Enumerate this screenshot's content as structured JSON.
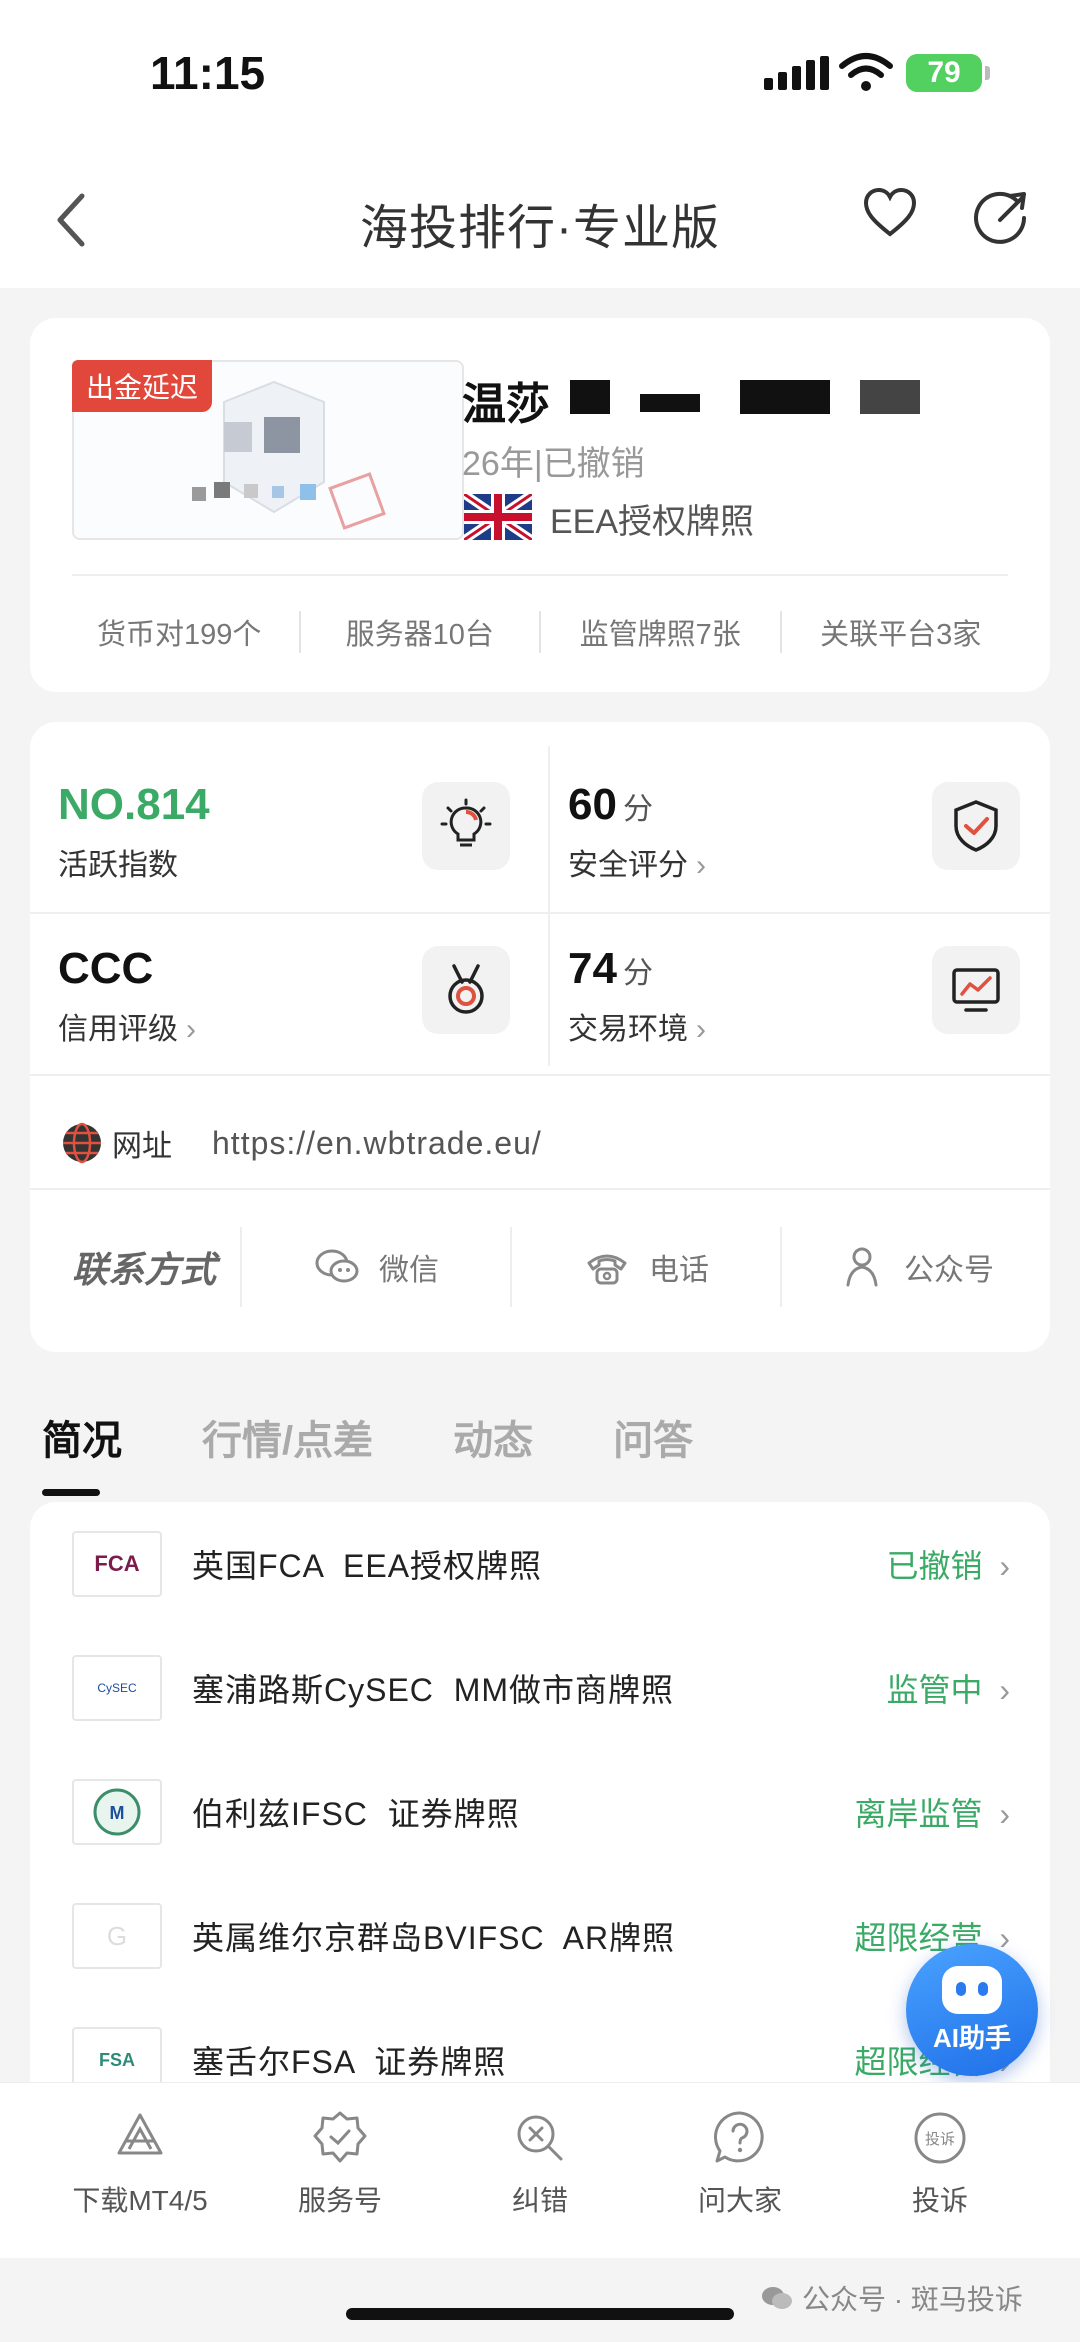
{
  "status_bar": {
    "time": "11:15",
    "battery": "79"
  },
  "nav": {
    "title": "海投排行·专业版"
  },
  "broker": {
    "delay_badge": "出金延迟",
    "name": "温莎",
    "meta": "26年|已撤销",
    "license": "EEA授权牌照",
    "stats": [
      "货币对199个",
      "服务器10台",
      "监管牌照7张",
      "关联平台3家"
    ]
  },
  "scores": {
    "activity": {
      "value": "NO.814",
      "label": "活跃指数"
    },
    "safety": {
      "value": "60",
      "unit": "分",
      "label": "安全评分"
    },
    "credit": {
      "value": "CCC",
      "label": "信用评级"
    },
    "trading": {
      "value": "74",
      "unit": "分",
      "label": "交易环境"
    }
  },
  "website": {
    "label": "网址",
    "url": "https://en.wbtrade.eu/"
  },
  "contact": {
    "title": "联系方式",
    "items": [
      "微信",
      "电话",
      "公众号"
    ]
  },
  "tabs": [
    "简况",
    "行情/点差",
    "动态",
    "问答"
  ],
  "licenses": [
    {
      "logo": "FCA",
      "name": "英国FCA  EEA授权牌照",
      "status": "已撤销"
    },
    {
      "logo": "CySEC",
      "name": "塞浦路斯CySEC  MM做市商牌照",
      "status": "监管中"
    },
    {
      "logo": "IFSC",
      "name": "伯利兹IFSC  证券牌照",
      "status": "离岸监管"
    },
    {
      "logo": "G",
      "name": "英属维尔京群岛BVIFSC  AR牌照",
      "status": "超限经营"
    },
    {
      "logo": "FSA",
      "name": "塞舌尔FSA  证券牌照",
      "status": "超限经营"
    }
  ],
  "ai_button": "AI助手",
  "tabbar": [
    "下载MT4/5",
    "服务号",
    "纠错",
    "问大家",
    "投诉"
  ],
  "tabbar_badge": "投诉",
  "watermark": "公众号 · 斑马投诉",
  "colors": {
    "accent_green": "#3aaa66",
    "delay_red": "#e2473b",
    "ai_blue": "#1f6fe8"
  }
}
